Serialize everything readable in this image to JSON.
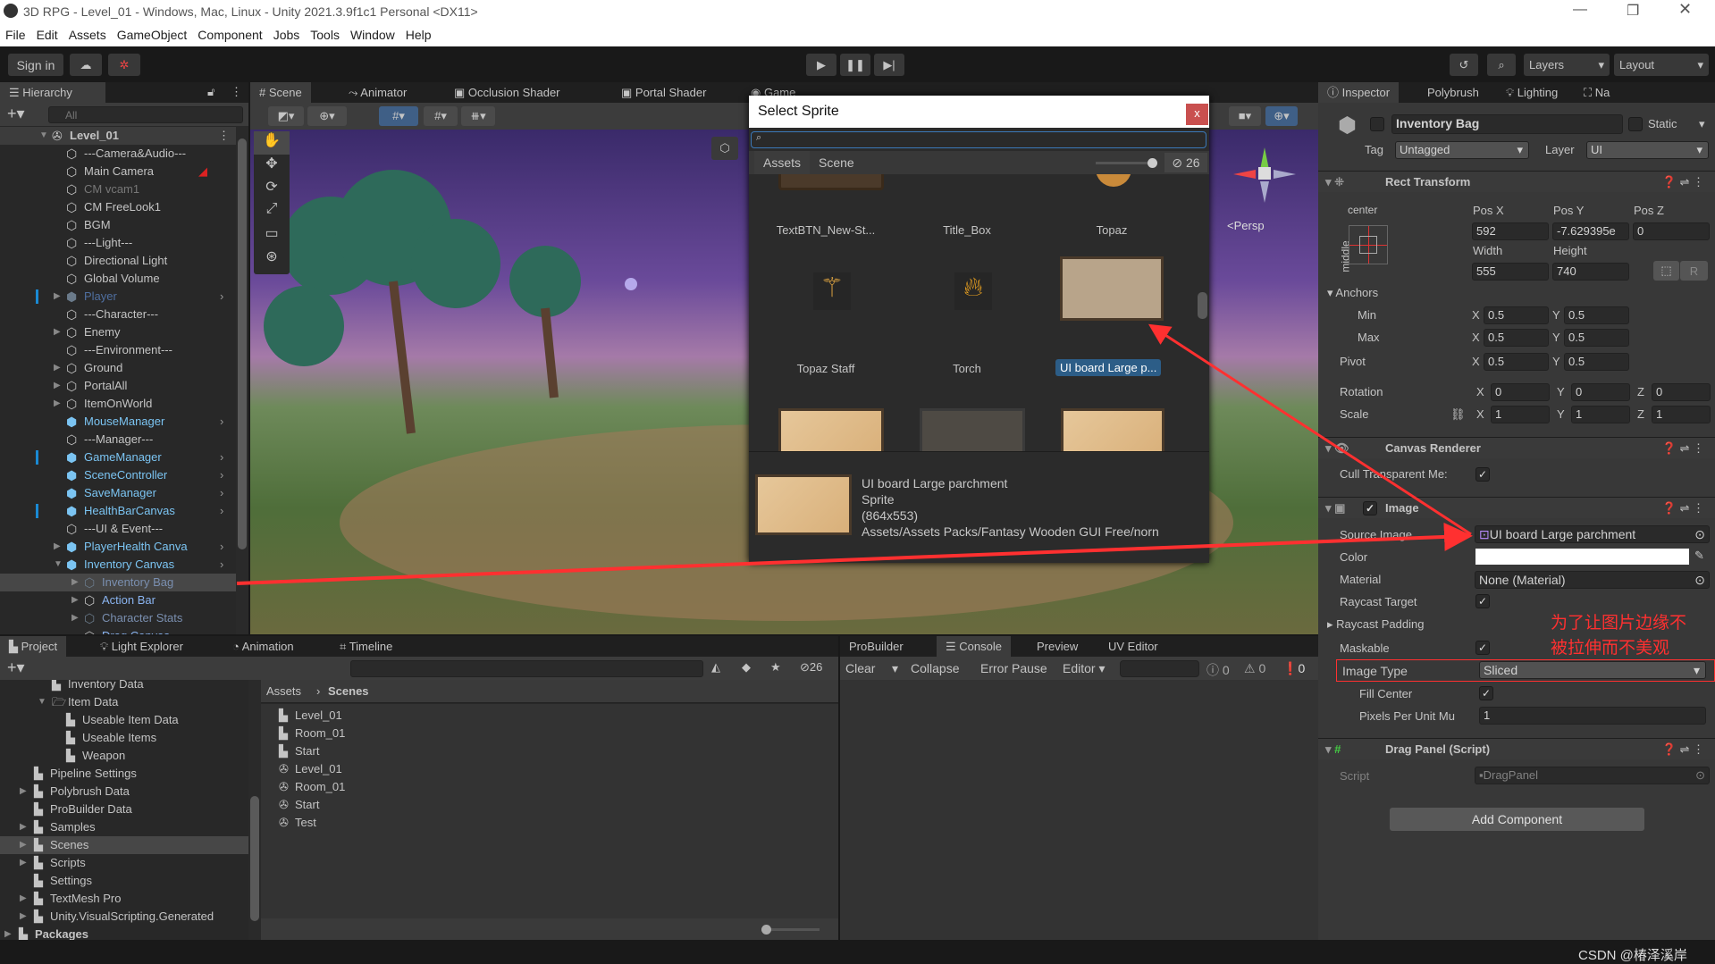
{
  "window": {
    "title": "3D RPG - Level_01 - Windows, Mac, Linux - Unity 2021.3.9f1c1 Personal <DX11>"
  },
  "menu": [
    "File",
    "Edit",
    "Assets",
    "GameObject",
    "Component",
    "Jobs",
    "Tools",
    "Window",
    "Help"
  ],
  "toolbar": {
    "sign_in": "Sign in",
    "layers": "Layers",
    "layout": "Layout"
  },
  "hierarchy": {
    "tab": "Hierarchy",
    "search_placeholder": "All",
    "items": [
      {
        "label": "Level_01",
        "level": 0,
        "kind": "scene",
        "exp": "open"
      },
      {
        "label": "---Camera&Audio---",
        "level": 1
      },
      {
        "label": "Main Camera",
        "level": 1,
        "badge": true
      },
      {
        "label": "CM vcam1",
        "level": 1,
        "state": "disabled"
      },
      {
        "label": "CM FreeLook1",
        "level": 1
      },
      {
        "label": "BGM",
        "level": 1
      },
      {
        "label": "---Light---",
        "level": 1
      },
      {
        "label": "Directional Light",
        "level": 1
      },
      {
        "label": "Global Volume",
        "level": 1
      },
      {
        "label": "Player",
        "level": 1,
        "kind": "prefab",
        "exp": "closed",
        "state": "dim",
        "more": true,
        "mark": true
      },
      {
        "label": "---Character---",
        "level": 1
      },
      {
        "label": "Enemy",
        "level": 1,
        "exp": "closed"
      },
      {
        "label": "---Environment---",
        "level": 1
      },
      {
        "label": "Ground",
        "level": 1,
        "exp": "closed"
      },
      {
        "label": "PortalAll",
        "level": 1,
        "exp": "closed"
      },
      {
        "label": "ItemOnWorld",
        "level": 1,
        "exp": "closed"
      },
      {
        "label": "MouseManager",
        "level": 1,
        "kind": "prefab",
        "more": true
      },
      {
        "label": "---Manager---",
        "level": 1
      },
      {
        "label": "GameManager",
        "level": 1,
        "kind": "prefab",
        "more": true,
        "mark": true
      },
      {
        "label": "SceneController",
        "level": 1,
        "kind": "prefab",
        "more": true
      },
      {
        "label": "SaveManager",
        "level": 1,
        "kind": "prefab",
        "more": true
      },
      {
        "label": "HealthBarCanvas",
        "level": 1,
        "kind": "prefab",
        "more": true,
        "mark": true
      },
      {
        "label": "---UI & Event---",
        "level": 1
      },
      {
        "label": "PlayerHealth Canva",
        "level": 1,
        "kind": "prefab",
        "exp": "closed",
        "more": true
      },
      {
        "label": "Inventory Canvas",
        "level": 1,
        "kind": "prefab",
        "exp": "open",
        "more": true
      },
      {
        "label": "Inventory Bag",
        "level": 2,
        "exp": "closed",
        "state": "dimblue",
        "selected": true
      },
      {
        "label": "Action Bar",
        "level": 2,
        "exp": "closed",
        "state": "blue"
      },
      {
        "label": "Character Stats",
        "level": 2,
        "exp": "closed",
        "state": "dimblue"
      },
      {
        "label": "Drag Canvas",
        "level": 2,
        "state": "blue"
      }
    ]
  },
  "scene": {
    "tabs": [
      "Scene",
      "Animator",
      "Occlusion Shader",
      "Portal Shader",
      "Game"
    ],
    "persp": "<Persp"
  },
  "sprite_picker": {
    "title": "Select Sprite",
    "close": "x",
    "tabs": [
      "Assets",
      "Scene"
    ],
    "hidden_count": "26",
    "items": [
      {
        "label": "TextBTN_New-St..."
      },
      {
        "label": "Title_Box"
      },
      {
        "label": "Topaz"
      },
      {
        "label": "Topaz Staff"
      },
      {
        "label": "Torch"
      },
      {
        "label": "UI board Large  p...",
        "selected": true
      }
    ],
    "preview": {
      "name": "UI board Large  parchment",
      "type": "Sprite",
      "size": "(864x553)",
      "path": "Assets/Assets Packs/Fantasy Wooden GUI  Free/norn"
    }
  },
  "inspector": {
    "tabs": [
      "Inspector",
      "Polybrush",
      "Lighting",
      "Na"
    ],
    "object_name": "Inventory Bag",
    "static": "Static",
    "tag_label": "Tag",
    "tag": "Untagged",
    "layer_label": "Layer",
    "layer": "UI",
    "rect": {
      "title": "Rect Transform",
      "anchor_h": "center",
      "anchor_v": "middle",
      "pos_x_label": "Pos X",
      "pos_y_label": "Pos Y",
      "pos_z_label": "Pos Z",
      "pos_x": "592",
      "pos_y": "-7.629395e",
      "pos_z": "0",
      "width_label": "Width",
      "height_label": "Height",
      "width": "555",
      "height": "740",
      "r": "R",
      "anchors": "Anchors",
      "min": "Min",
      "max": "Max",
      "pivot": "Pivot",
      "min_x": "0.5",
      "min_y": "0.5",
      "max_x": "0.5",
      "max_y": "0.5",
      "pivot_x": "0.5",
      "pivot_y": "0.5",
      "rotation": "Rotation",
      "scale": "Scale",
      "rot": [
        "0",
        "0",
        "0"
      ],
      "scl": [
        "1",
        "1",
        "1"
      ],
      "X": "X",
      "Y": "Y",
      "Z": "Z"
    },
    "canvas_renderer": {
      "title": "Canvas Renderer",
      "cull": "Cull Transparent Me:"
    },
    "image": {
      "title": "Image",
      "source_label": "Source Image",
      "source": "UI board Large  parchment",
      "color_label": "Color",
      "color": "#ffffff",
      "material_label": "Material",
      "material": "None (Material)",
      "raycast_target": "Raycast Target",
      "raycast_padding": "Raycast Padding",
      "maskable": "Maskable",
      "image_type_label": "Image Type",
      "image_type": "Sliced",
      "fill_center": "Fill Center",
      "ppu_label": "Pixels Per Unit Mu",
      "ppu": "1"
    },
    "drag_panel": {
      "title": "Drag Panel (Script)",
      "script_label": "Script",
      "script": "DragPanel"
    },
    "add_component": "Add Component",
    "annotation": "为了让图片边缘不\n被拉伸而不美观"
  },
  "project": {
    "tabs": [
      "Project",
      "Light Explorer",
      "Animation",
      "Timeline"
    ],
    "hidden_count": "26",
    "tree": [
      {
        "label": "Inventory Data",
        "level": 2
      },
      {
        "label": "Item Data",
        "level": 2,
        "exp": "open"
      },
      {
        "label": "Useable Item Data",
        "level": 3
      },
      {
        "label": "Useable Items",
        "level": 3
      },
      {
        "label": "Weapon",
        "level": 3
      },
      {
        "label": "Pipeline Settings",
        "level": 1
      },
      {
        "label": "Polybrush Data",
        "level": 1,
        "exp": "closed"
      },
      {
        "label": "ProBuilder Data",
        "level": 1
      },
      {
        "label": "Samples",
        "level": 1,
        "exp": "closed"
      },
      {
        "label": "Scenes",
        "level": 1,
        "exp": "closed",
        "selected": true
      },
      {
        "label": "Scripts",
        "level": 1,
        "exp": "closed"
      },
      {
        "label": "Settings",
        "level": 1
      },
      {
        "label": "TextMesh Pro",
        "level": 1,
        "exp": "closed"
      },
      {
        "label": "Unity.VisualScripting.Generated",
        "level": 1,
        "exp": "closed"
      },
      {
        "label": "Packages",
        "level": 0,
        "exp": "closed",
        "bold": true
      }
    ],
    "breadcrumb": [
      "Assets",
      "Scenes"
    ],
    "assets": [
      {
        "label": "Level_01",
        "kind": "folder"
      },
      {
        "label": "Room_01",
        "kind": "folder"
      },
      {
        "label": "Start",
        "kind": "folder"
      },
      {
        "label": "Level_01",
        "kind": "scene"
      },
      {
        "label": "Room_01",
        "kind": "scene"
      },
      {
        "label": "Start",
        "kind": "scene"
      },
      {
        "label": "Test",
        "kind": "scene"
      }
    ]
  },
  "console": {
    "tabs": [
      "ProBuilder",
      "Console",
      "Preview",
      "UV Editor"
    ],
    "clear": "Clear",
    "collapse": "Collapse",
    "error_pause": "Error Pause",
    "editor": "Editor",
    "logs": "0",
    "warnings": "0",
    "errors": "0"
  },
  "watermark": "CSDN @椿泽溪岸",
  "colors": {
    "accent": "#2c5d87",
    "annotation": "#ff3030",
    "prefab": "#7bc4f2"
  }
}
